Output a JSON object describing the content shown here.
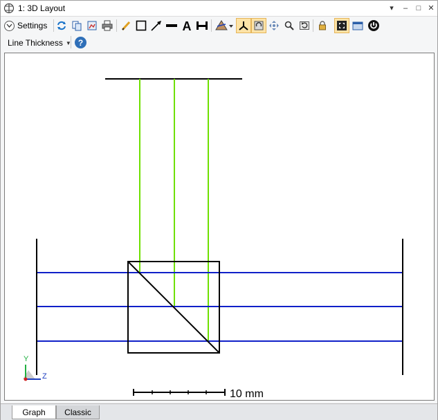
{
  "window": {
    "title": "1: 3D Layout",
    "controls": [
      "▾",
      "–",
      "□",
      "✕"
    ]
  },
  "toolbar": {
    "settings_label": "Settings",
    "line_thickness_label": "Line Thickness",
    "help_label": "?"
  },
  "icons": [
    "refresh-icon",
    "copy-icon",
    "save-icon",
    "print-icon",
    "pencil-icon",
    "rectangle-icon",
    "arrow-icon",
    "line-icon",
    "text-icon",
    "dimension-icon",
    "view-orientation-icon",
    "axes-icon",
    "rotate-icon",
    "pan-icon",
    "zoom-icon",
    "reset-view-icon",
    "lock-icon",
    "fit-icon",
    "window-icon",
    "power-icon"
  ],
  "layout_view": {
    "scale_bar_label": "10 mm",
    "axis_labels": {
      "y": "Y",
      "z": "Z"
    },
    "colors": {
      "green_rays": "#6ee000",
      "blue_rays": "#1020c8",
      "optics": "#000000"
    }
  },
  "tabs": [
    {
      "label": "Graph",
      "active": true
    },
    {
      "label": "Classic",
      "active": false
    }
  ]
}
